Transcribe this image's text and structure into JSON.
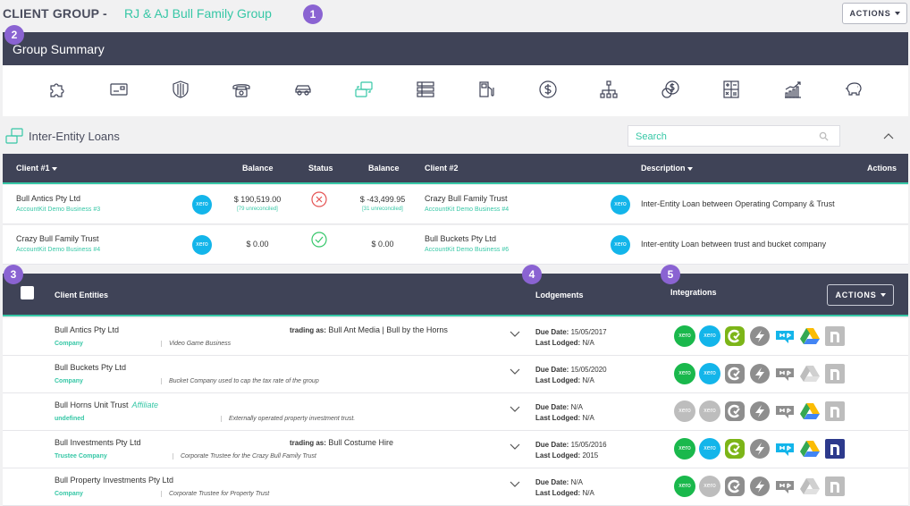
{
  "header": {
    "label": "CLIENT GROUP -",
    "group_name": "RJ & AJ Bull Family Group",
    "actions_label": "ACTIONS"
  },
  "markers": [
    "1",
    "2",
    "3",
    "4",
    "5"
  ],
  "summary": {
    "title": "Group Summary",
    "icons": [
      "puzzle-icon",
      "card-icon",
      "shield-icon",
      "phone-icon",
      "car-icon",
      "loans-icon",
      "list-icon",
      "fuel-icon",
      "dollar-icon",
      "hierarchy-icon",
      "coins-icon",
      "calculator-icon",
      "growth-chart-icon",
      "piggy-bank-icon"
    ]
  },
  "loans": {
    "title": "Inter-Entity Loans",
    "search_placeholder": "Search",
    "columns": {
      "client1": "Client #1",
      "balance1": "Balance",
      "status": "Status",
      "balance2": "Balance",
      "client2": "Client #2",
      "description": "Description",
      "actions": "Actions"
    },
    "rows": [
      {
        "client1": "Bull Antics Pty Ltd",
        "client1_sub": "AccountKit Demo Business #3",
        "xero1": "xero",
        "balance1": "$ 190,519.00",
        "balance1_sub": "[79 unreconciled]",
        "status": "error",
        "balance2": "$ -43,499.95",
        "balance2_sub": "[31 unreconciled]",
        "client2": "Crazy Bull Family Trust",
        "client2_sub": "AccountKit Demo Business #4",
        "xero2": "xero",
        "description": "Inter-Entity Loan between Operating Company & Trust"
      },
      {
        "client1": "Crazy Bull Family Trust",
        "client1_sub": "AccountKit Demo Business #4",
        "xero1": "xero",
        "balance1": "$ 0.00",
        "balance1_sub": "",
        "status": "ok",
        "balance2": "$ 0.00",
        "balance2_sub": "",
        "client2": "Bull Buckets Pty Ltd",
        "client2_sub": "AccountKit Demo Business #6",
        "xero2": "xero",
        "description": "Inter-entity Loan between trust and bucket company"
      }
    ]
  },
  "entities": {
    "columns": {
      "client_entities": "Client Entities",
      "lodgements": "Lodgements",
      "integrations": "Integrations"
    },
    "actions_label": "ACTIONS",
    "due_label": "Due Date:",
    "lodged_label": "Last Lodged:",
    "trading_label": "trading as:",
    "rows": [
      {
        "name": "Bull Antics Pty Ltd",
        "affiliate": "",
        "type": "Company",
        "desc": "Video Game Business",
        "trading": "Bull Ant Media | Bull by the Horns",
        "due": "15/05/2017",
        "lodged": "N/A",
        "integrations": [
          true,
          true,
          true,
          false,
          true,
          true,
          false
        ]
      },
      {
        "name": "Bull Buckets Pty Ltd",
        "affiliate": "",
        "type": "Company",
        "desc": "Bucket Company used to cap the tax rate of the group",
        "trading": "",
        "due": "15/05/2020",
        "lodged": "N/A",
        "integrations": [
          true,
          true,
          false,
          false,
          false,
          false,
          false
        ]
      },
      {
        "name": "Bull Horns Unit Trust",
        "affiliate": "Affiliate",
        "type": "undefined",
        "desc": "Externally operated property investment trust.",
        "trading": "",
        "due": "N/A",
        "lodged": "N/A",
        "integrations": [
          false,
          false,
          false,
          false,
          false,
          true,
          false
        ]
      },
      {
        "name": "Bull Investments Pty Ltd",
        "affiliate": "",
        "type": "Trustee Company",
        "desc": "Corporate Trustee for the Crazy Bull Family Trust",
        "trading": "Bull Costume Hire",
        "due": "15/05/2016",
        "lodged": "2015",
        "integrations": [
          true,
          true,
          true,
          false,
          true,
          true,
          true
        ]
      },
      {
        "name": "Bull Property Investments Pty Ltd",
        "affiliate": "",
        "type": "Company",
        "desc": "Corporate Trustee for Property Trust",
        "trading": "",
        "due": "N/A",
        "lodged": "N/A",
        "integrations": [
          true,
          false,
          false,
          false,
          false,
          false,
          false
        ]
      }
    ]
  },
  "colors": {
    "header_bg": "#3f4357",
    "accent": "#36c7a6",
    "xero": "#13b5ea",
    "xero_green": "#1ab84c",
    "marker": "#8a63d2"
  }
}
